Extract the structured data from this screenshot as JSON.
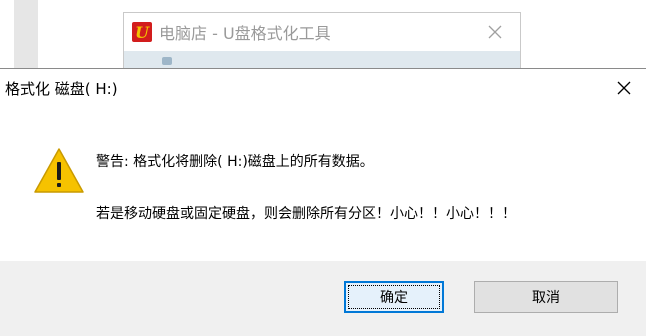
{
  "background_window": {
    "title": "电脑店 - U盘格式化工具",
    "logo_letter": "U",
    "colors": {
      "logo_bg": "#d21d1d",
      "logo_fg": "#f3c300"
    }
  },
  "dialog": {
    "title": "格式化 磁盘( H:)",
    "message_line1": "警告: 格式化将删除( H:)磁盘上的所有数据。",
    "message_line2": "若是移动硬盘或固定硬盘，则会删除所有分区！小心！！小心！！！",
    "icon": "warning-icon",
    "buttons": {
      "ok_label": "确定",
      "cancel_label": "取消"
    },
    "colors": {
      "focus_border": "#0078d7",
      "warning_fill": "#f6c200"
    }
  }
}
